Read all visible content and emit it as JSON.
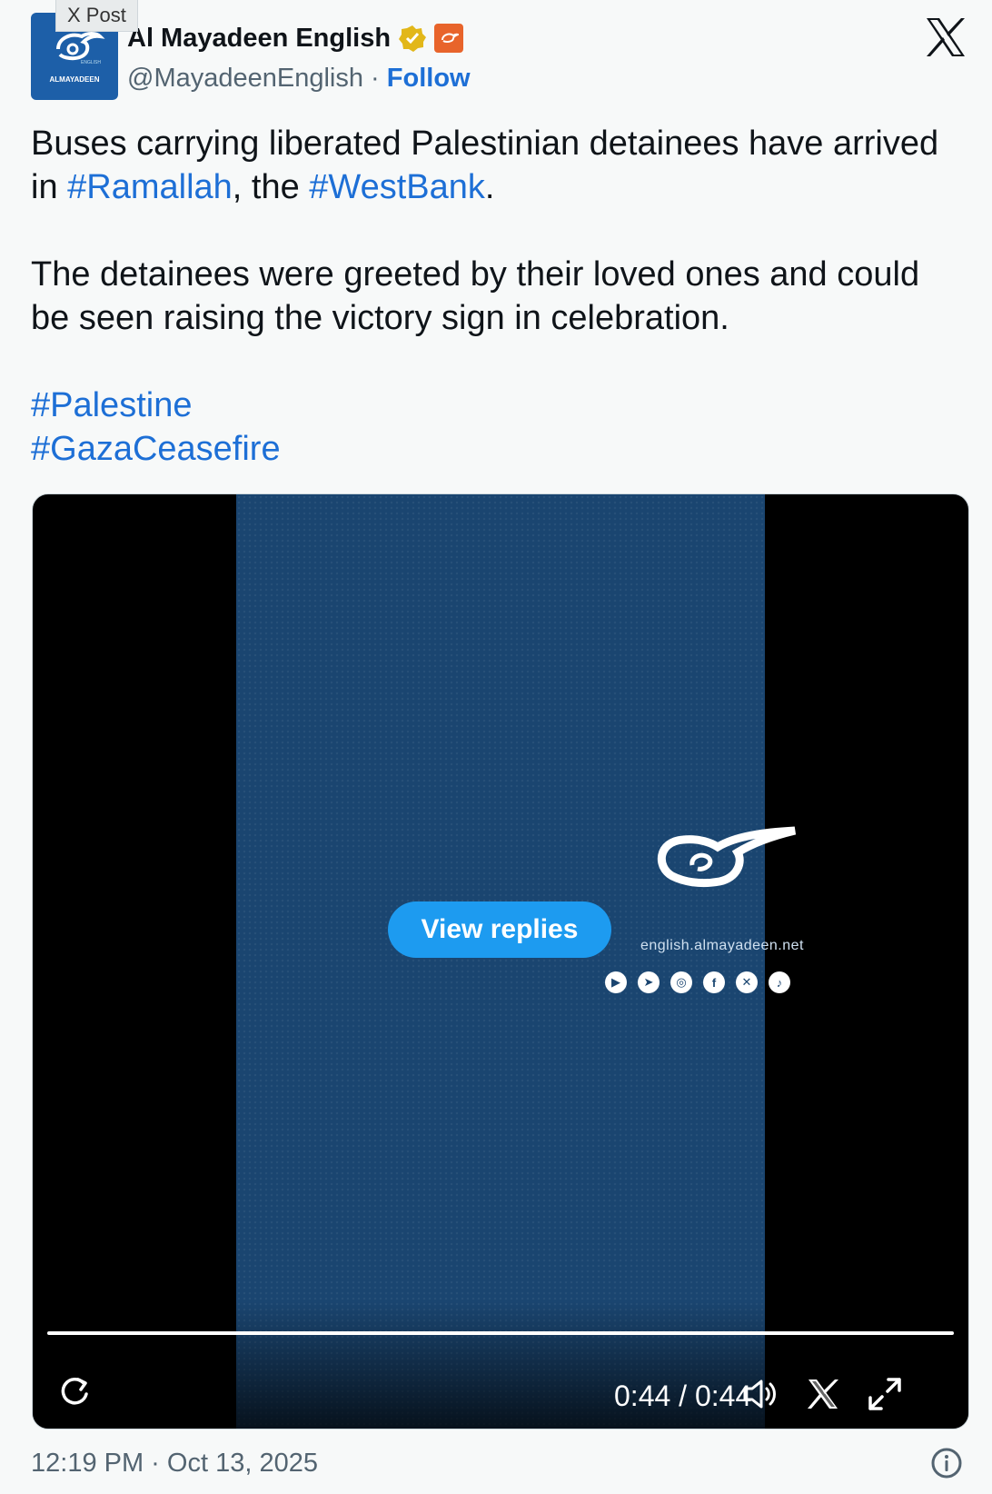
{
  "window": {
    "tag_label": "X Post"
  },
  "author": {
    "display_name": "Al Mayadeen English",
    "handle": "@MayadeenEnglish",
    "separator": "·",
    "follow_label": "Follow",
    "avatar_text": "ALMAYADEEN",
    "avatar_small_text": "ENGLISH"
  },
  "tweet": {
    "line1_a": "Buses carrying liberated Palestinian detainees have arrived",
    "line2_a": "in ",
    "hashtag_ramallah": "#Ramallah",
    "line2_b": ", the ",
    "hashtag_westbank": "#WestBank",
    "line2_c": ".",
    "para2": "The detainees were greeted by their loved ones and could be seen raising the victory sign in celebration.",
    "hashtag_palestine": "#Palestine",
    "hashtag_gaza": "#GazaCeasefire"
  },
  "video": {
    "view_replies_label": "View replies",
    "time_display": "0:44 / 0:44",
    "progress": 1.0,
    "url_text": "english.almayadeen.net",
    "social_icons": [
      "youtube-icon",
      "telegram-icon",
      "instagram-icon",
      "facebook-icon",
      "x-icon",
      "tiktok-icon"
    ]
  },
  "footer": {
    "timestamp": "12:19 PM · Oct 13, 2025"
  },
  "colors": {
    "link": "#1d6fd6",
    "video_bg": "#1a4570",
    "view_replies_bg": "#1d9bf0"
  }
}
